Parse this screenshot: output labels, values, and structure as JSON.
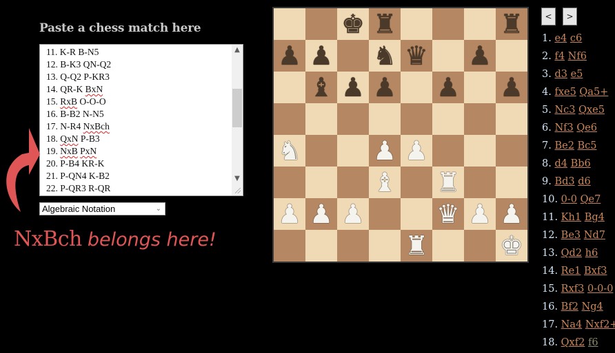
{
  "input_panel": {
    "heading": "Paste a chess match here",
    "textarea_lines": [
      {
        "num": "11.",
        "w": "K-R",
        "b": "B-N5",
        "w_spell": false,
        "b_spell": false
      },
      {
        "num": "12.",
        "w": "B-K3",
        "b": "QN-Q2",
        "w_spell": false,
        "b_spell": false
      },
      {
        "num": "13.",
        "w": "Q-Q2",
        "b": "P-KR3",
        "w_spell": false,
        "b_spell": false
      },
      {
        "num": "14.",
        "w": "QR-K",
        "b": "BxN",
        "w_spell": false,
        "b_spell": true
      },
      {
        "num": "15.",
        "w": "RxB",
        "b": "O-O-O",
        "w_spell": true,
        "b_spell": false
      },
      {
        "num": "16.",
        "w": "B-B2",
        "b": "N-N5",
        "w_spell": false,
        "b_spell": false
      },
      {
        "num": "17.",
        "w": "N-R4",
        "b": "NxBch",
        "w_spell": false,
        "b_spell": true
      },
      {
        "num": "18.",
        "w": "QxN",
        "b": "P-B3",
        "w_spell": true,
        "b_spell": false
      },
      {
        "num": "19.",
        "w": "NxB",
        "b": "PxN",
        "w_spell": true,
        "b_spell": true
      },
      {
        "num": "20.",
        "w": "P-B4",
        "b": "KR-K",
        "w_spell": false,
        "b_spell": false
      },
      {
        "num": "21.",
        "w": "P-QN4",
        "b": "K-B2",
        "w_spell": false,
        "b_spell": false
      },
      {
        "num": "22.",
        "w": "P-QR3",
        "b": "R-QR",
        "w_spell": false,
        "b_spell": false
      }
    ],
    "notation_select": {
      "selected": "Algebraic Notation"
    }
  },
  "annotation": {
    "move": "NxBch",
    "text": "belongs here!",
    "color": "#e05555"
  },
  "board": {
    "light_color": "#f0d9b5",
    "dark_color": "#b58863",
    "ranks": [
      [
        "",
        "",
        "bK",
        "bR",
        "",
        "",
        "",
        "bR"
      ],
      [
        "bP",
        "bP",
        "",
        "bN",
        "bQ",
        "",
        "bP",
        ""
      ],
      [
        "",
        "bB",
        "bP",
        "bP",
        "",
        "bP",
        "",
        "bP"
      ],
      [
        "",
        "",
        "",
        "",
        "",
        "",
        "",
        ""
      ],
      [
        "wN",
        "",
        "",
        "wP",
        "wP",
        "",
        "",
        ""
      ],
      [
        "",
        "",
        "",
        "wB",
        "",
        "wR",
        "",
        ""
      ],
      [
        "wP",
        "wP",
        "wP",
        "",
        "",
        "wQ",
        "wP",
        "wP"
      ],
      [
        "",
        "",
        "",
        "",
        "wR",
        "",
        "",
        "wK"
      ]
    ]
  },
  "navigation": {
    "prev_label": "<",
    "next_label": ">"
  },
  "moves": [
    {
      "num": "1.",
      "w": "e4",
      "b": "c6"
    },
    {
      "num": "2.",
      "w": "f4",
      "b": "Nf6"
    },
    {
      "num": "3.",
      "w": "d3",
      "b": "e5"
    },
    {
      "num": "4.",
      "w": "fxe5",
      "b": "Qa5+"
    },
    {
      "num": "5.",
      "w": "Nc3",
      "b": "Qxe5"
    },
    {
      "num": "6.",
      "w": "Nf3",
      "b": "Qe6"
    },
    {
      "num": "7.",
      "w": "Be2",
      "b": "Bc5"
    },
    {
      "num": "8.",
      "w": "d4",
      "b": "Bb6"
    },
    {
      "num": "9.",
      "w": "Bd3",
      "b": "d6"
    },
    {
      "num": "10.",
      "w": "0-0",
      "b": "Qe7"
    },
    {
      "num": "11.",
      "w": "Kh1",
      "b": "Bg4"
    },
    {
      "num": "12.",
      "w": "Be3",
      "b": "Nd7"
    },
    {
      "num": "13.",
      "w": "Qd2",
      "b": "h6"
    },
    {
      "num": "14.",
      "w": "Re1",
      "b": "Bxf3"
    },
    {
      "num": "15.",
      "w": "Rxf3",
      "b": "0-0-0"
    },
    {
      "num": "16.",
      "w": "Bf2",
      "b": "Ng4"
    },
    {
      "num": "17.",
      "w": "Na4",
      "b": "Nxf2+"
    },
    {
      "num": "18.",
      "w": "Qxf2",
      "b": "f6",
      "current": "b"
    }
  ],
  "colors": {
    "move_link": "#c8865a",
    "current_move": "#8a8a6a",
    "move_number": "#cfe3f5"
  }
}
